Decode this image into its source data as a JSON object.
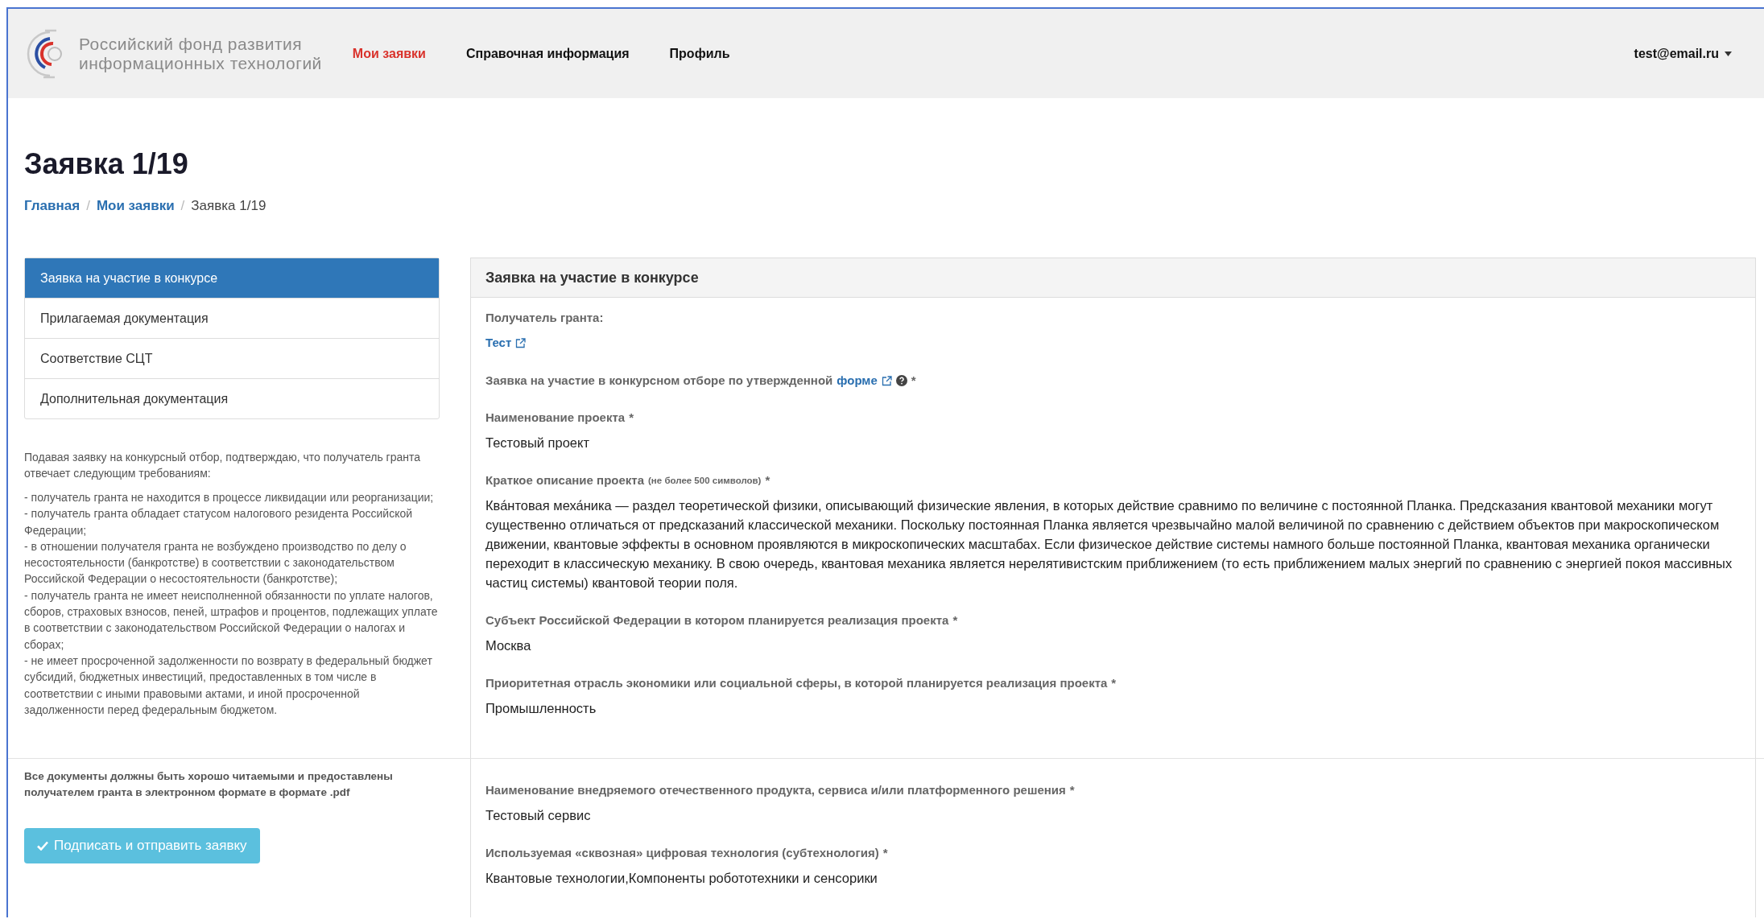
{
  "header": {
    "logo_lines": [
      "Российский фонд развития",
      "информационных технологий"
    ],
    "nav": [
      {
        "label": "Мои заявки",
        "selected": true
      },
      {
        "label": "Справочная информация",
        "selected": false
      },
      {
        "label": "Профиль",
        "selected": false
      }
    ],
    "user_menu": "test@email.ru"
  },
  "page_title": "Заявка 1/19",
  "breadcrumb_separator": "/",
  "breadcrumbs": [
    {
      "label": "Главная",
      "link": true
    },
    {
      "label": "Мои заявки",
      "link": true
    },
    {
      "label": "Заявка 1/19",
      "link": false
    }
  ],
  "sidebar": {
    "items": [
      {
        "label": "Заявка на участие в конкурсе",
        "selected": true
      },
      {
        "label": "Прилагаемая документация",
        "selected": false
      },
      {
        "label": "Соответствие СЦТ",
        "selected": false
      },
      {
        "label": "Дополнительная документация",
        "selected": false
      }
    ],
    "intro": "Подавая заявку на конкурсный отбор, подтверждаю, что получатель гранта отвечает следующим требованиям:",
    "requirements": [
      "- получатель гранта не находится в процессе ликвидации или реорганизации;",
      "- получатель гранта обладает статусом налогового резидента Российской Федерации;",
      "- в отношении получателя гранта не возбуждено производство по делу о несостоятельности (банкротстве) в соответствии с законодательством Российской Федерации о несостоятельности (банкротстве);",
      "- получатель гранта не имеет неисполненной обязанности по уплате налогов, сборов, страховых взносов, пеней, штрафов и процентов, подлежащих уплате в соответствии с законодательством Российской Федерации о налогах и сборах;",
      "- не имеет просроченной задолженности по возврату в федеральный бюджет субсидий, бюджетных инвестиций, предоставленных в том числе в соответствии с иными правовыми актами, и иной просроченной задолженности перед федеральным бюджетом."
    ],
    "note": "Все документы должны быть хорошо читаемыми и предоставлены получателем гранта в электронном формате в формате .pdf",
    "submit_button": "Подписать и отправить заявку"
  },
  "panel": {
    "title": "Заявка на участие в конкурсе",
    "fields": [
      {
        "kind": "link",
        "label": "Получатель гранта:",
        "value": "Тест"
      },
      {
        "kind": "form-link",
        "label": "Заявка на участие в конкурсном отборе по утвержденной",
        "link": "форме",
        "required_mark": "*"
      },
      {
        "kind": "text",
        "label": "Наименование проекта",
        "required_mark": "*",
        "value": "Тестовый проект"
      },
      {
        "kind": "text",
        "label": "Краткое описание проекта",
        "note": "(не более 500 символов)",
        "required_mark": "*",
        "value": "Ква́нтовая меха́ника — раздел теоретической физики, описывающий физические явления, в которых действие сравнимо по величине с постоянной Планка. Предсказания квантовой механики могут существенно отличаться от предсказаний классической механики. Поскольку постоянная Планка является чрезвычайно малой величиной по сравнению с действием объектов при макроскопическом движении, квантовые эффекты в основном проявляются в микроскопических масштабах. Если физическое действие системы намного больше постоянной Планка, квантовая механика органически переходит в классическую механику. В свою очередь, квантовая механика является нерелятивистским приближением (то есть приближением малых энергий по сравнению с энергией покоя массивных частиц системы) квантовой теории поля."
      },
      {
        "kind": "text",
        "label": "Субъект Российской Федерации в котором планируется реализация проекта",
        "required_mark": "*",
        "value": "Москва"
      },
      {
        "kind": "text",
        "label": "Приоритетная отрасль экономики или социальной сферы, в которой планируется реализация проекта",
        "required_mark": "*",
        "value": "Промышленность"
      }
    ],
    "more_fields": [
      {
        "kind": "text",
        "label": "Наименование внедряемого отечественного продукта, сервиса и/или платформенного решения",
        "required_mark": "*",
        "value": "Тестовый сервис"
      },
      {
        "kind": "text",
        "label": "Используемая «сквозная» цифровая технология (субтехнология)",
        "required_mark": "*",
        "value": "Квантовые технологии,Компоненты робототехники и сенсорики"
      }
    ]
  }
}
